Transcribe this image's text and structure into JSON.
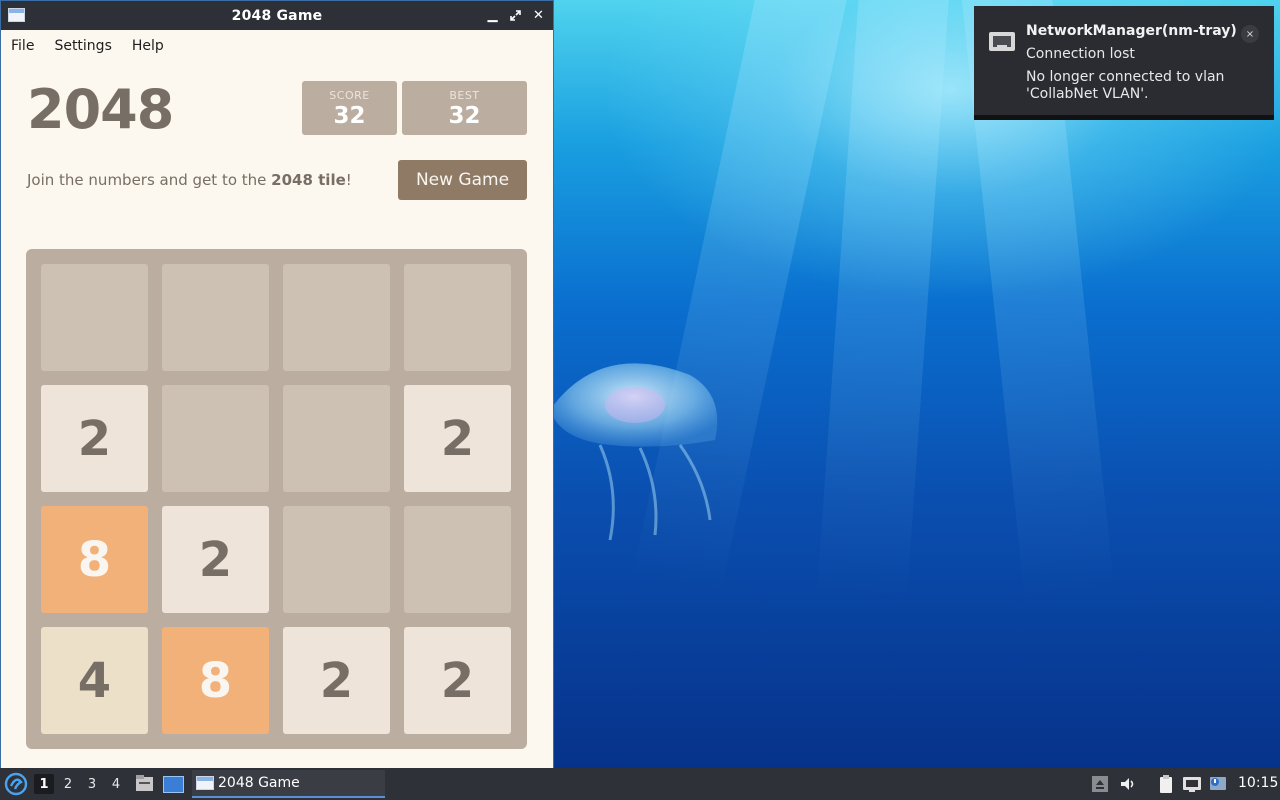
{
  "window": {
    "title": "2048 Game"
  },
  "menu": {
    "file": "File",
    "settings": "Settings",
    "help": "Help"
  },
  "game": {
    "title": "2048",
    "score_label": "SCORE",
    "score_value": "32",
    "best_label": "BEST",
    "best_value": "32",
    "intro_prefix": "Join the numbers and get to the ",
    "intro_bold": "2048 tile",
    "intro_suffix": "!",
    "new_game_label": "New Game"
  },
  "board": {
    "rows": [
      [
        "",
        "",
        "",
        ""
      ],
      [
        "2",
        "",
        "",
        "2"
      ],
      [
        "8",
        "2",
        "",
        ""
      ],
      [
        "4",
        "8",
        "2",
        "2"
      ]
    ],
    "tile_colors": {
      "empty": "#cdc1b4",
      "2": "#eee4da",
      "4": "#ede0c8",
      "8": "#f2b179"
    },
    "text_colors": {
      "dark": "#776e65",
      "light": "#f9f6f2"
    }
  },
  "notification": {
    "app": "NetworkManager(nm-tray)",
    "summary": "Connection lost",
    "body": "No longer connected to vlan 'CollabNet VLAN'.",
    "close": "×",
    "icon": "network-wired-icon"
  },
  "taskbar": {
    "workspaces": [
      "1",
      "2",
      "3",
      "4"
    ],
    "active_workspace": "1",
    "task_label": "2048 Game",
    "clock": "10:15"
  },
  "colors": {
    "accent": "#8f7a66",
    "board": "#bbada0",
    "background": "#fcf8ef"
  }
}
